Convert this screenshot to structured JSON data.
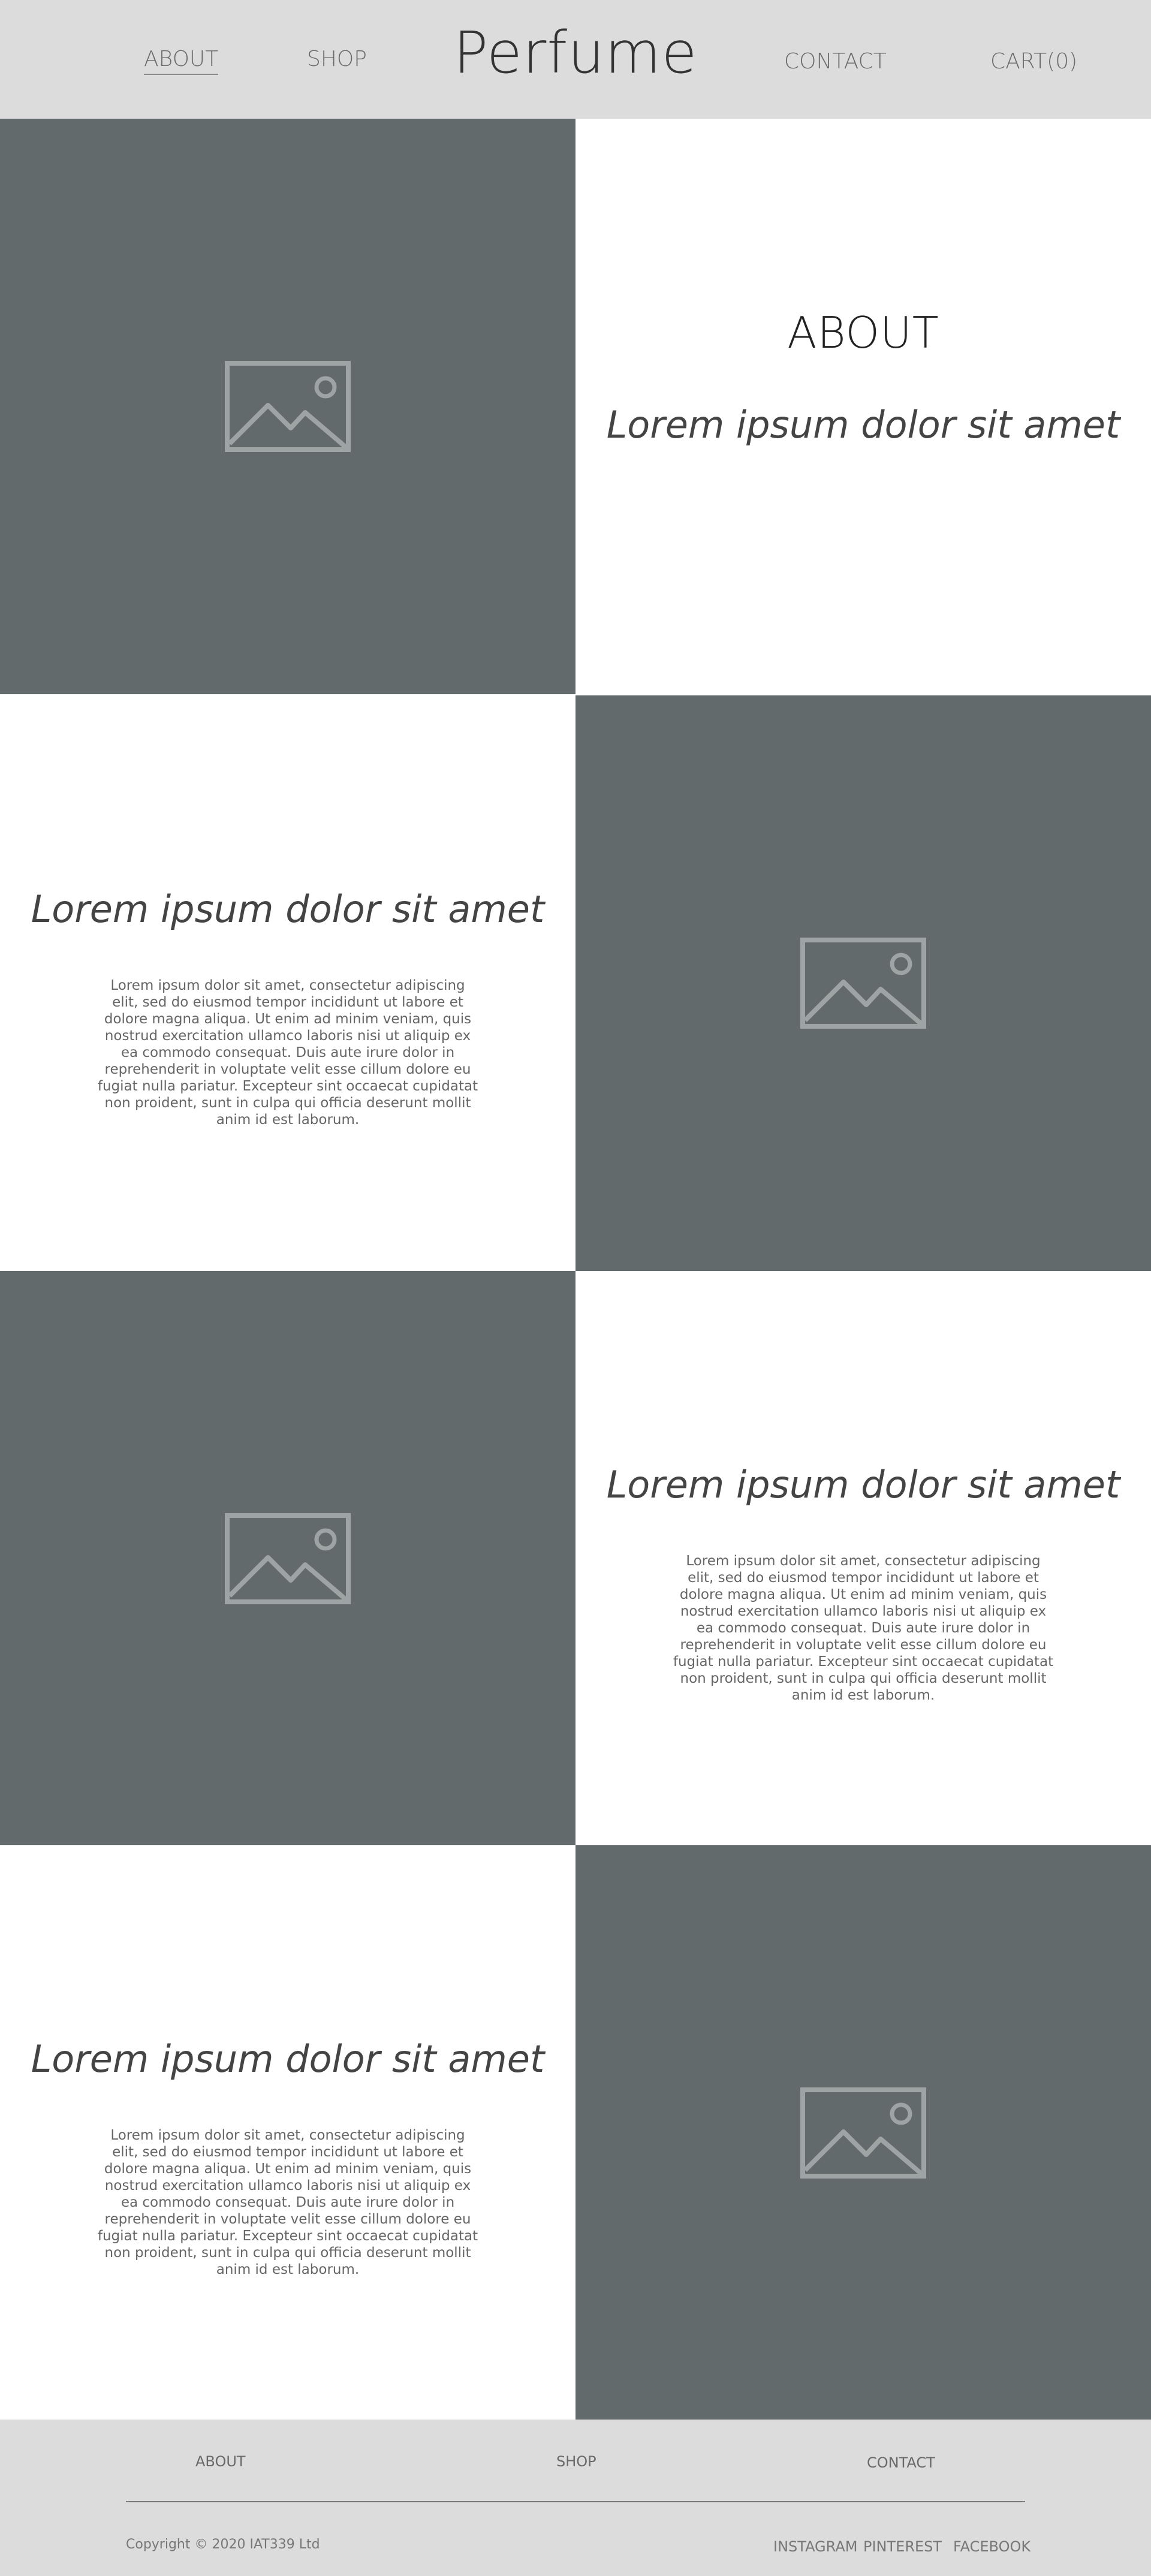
{
  "header": {
    "brand": "Perfume",
    "nav": {
      "about": "ABOUT",
      "shop": "SHOP",
      "contact": "CONTACT",
      "cart": "CART(0)"
    }
  },
  "about": {
    "heading": "ABOUT",
    "tagline": "Lorem ipsum dolor sit amet"
  },
  "sections": [
    {
      "title": "Lorem ipsum dolor sit amet",
      "body": "Lorem ipsum dolor sit amet, consectetur adipiscing elit, sed do eiusmod tempor incididunt ut labore et dolore magna aliqua. Ut enim ad minim veniam, quis nostrud exercitation ullamco laboris nisi ut aliquip ex ea commodo consequat. Duis aute irure dolor in reprehenderit in voluptate velit esse cillum dolore eu fugiat nulla pariatur. Excepteur sint occaecat cupidatat non proident, sunt in culpa qui officia deserunt mollit anim id est laborum."
    },
    {
      "title": "Lorem ipsum dolor sit amet",
      "body": "Lorem ipsum dolor sit amet, consectetur adipiscing elit, sed do eiusmod tempor incididunt ut labore et dolore magna aliqua. Ut enim ad minim veniam, quis nostrud exercitation ullamco laboris nisi ut aliquip ex ea commodo consequat. Duis aute irure dolor in reprehenderit in voluptate velit esse cillum dolore eu fugiat nulla pariatur. Excepteur sint occaecat cupidatat non proident, sunt in culpa qui officia deserunt mollit anim id est laborum."
    },
    {
      "title": "Lorem ipsum dolor sit amet",
      "body": "Lorem ipsum dolor sit amet, consectetur adipiscing elit, sed do eiusmod tempor incididunt ut labore et dolore magna aliqua. Ut enim ad minim veniam, quis nostrud exercitation ullamco laboris nisi ut aliquip ex ea commodo consequat. Duis aute irure dolor in reprehenderit in voluptate velit esse cillum dolore eu fugiat nulla pariatur. Excepteur sint occaecat cupidatat non proident, sunt in culpa qui officia deserunt mollit anim id est laborum."
    }
  ],
  "images": {
    "icon": "image-placeholder-icon",
    "background_color": "#636a6b"
  },
  "footer": {
    "nav": {
      "about": "ABOUT",
      "shop": "SHOP",
      "contact": "CONTACT"
    },
    "copyright": "Copyright © 2020 IAT339 Ltd",
    "social": {
      "instagram": "INSTAGRAM",
      "pinterest": "PINTEREST",
      "facebook": "FACEBOOK"
    }
  }
}
